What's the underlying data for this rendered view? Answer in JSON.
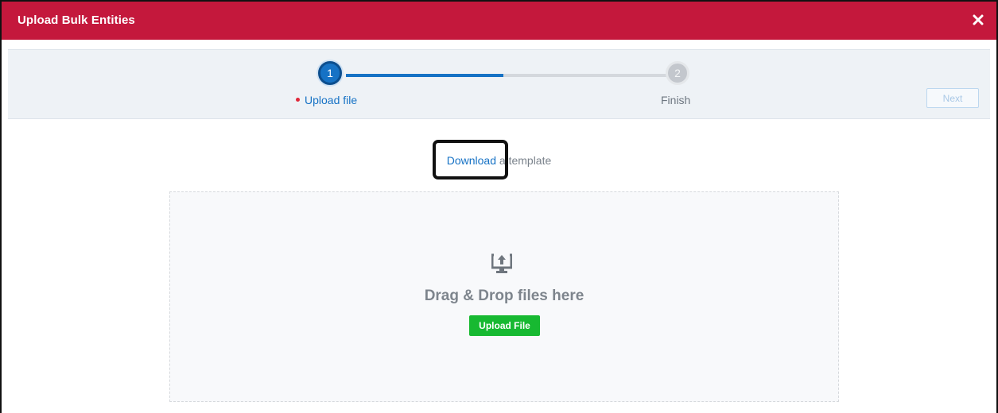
{
  "dialog": {
    "title": "Upload Bulk Entities",
    "close_icon": "close-icon",
    "header_color": "#c4183c"
  },
  "stepper": {
    "steps": [
      {
        "number": "1",
        "label": "Upload file",
        "state": "active"
      },
      {
        "number": "2",
        "label": "Finish",
        "state": "inactive"
      }
    ],
    "active_color": "#1672c5",
    "progress": 0.5,
    "next_label": "Next"
  },
  "template": {
    "link_text": "Download",
    "rest_text": " a template"
  },
  "dropzone": {
    "icon": "upload-to-computer-icon",
    "heading": "Drag & Drop files here",
    "button_label": "Upload File",
    "button_color": "#17b931"
  }
}
